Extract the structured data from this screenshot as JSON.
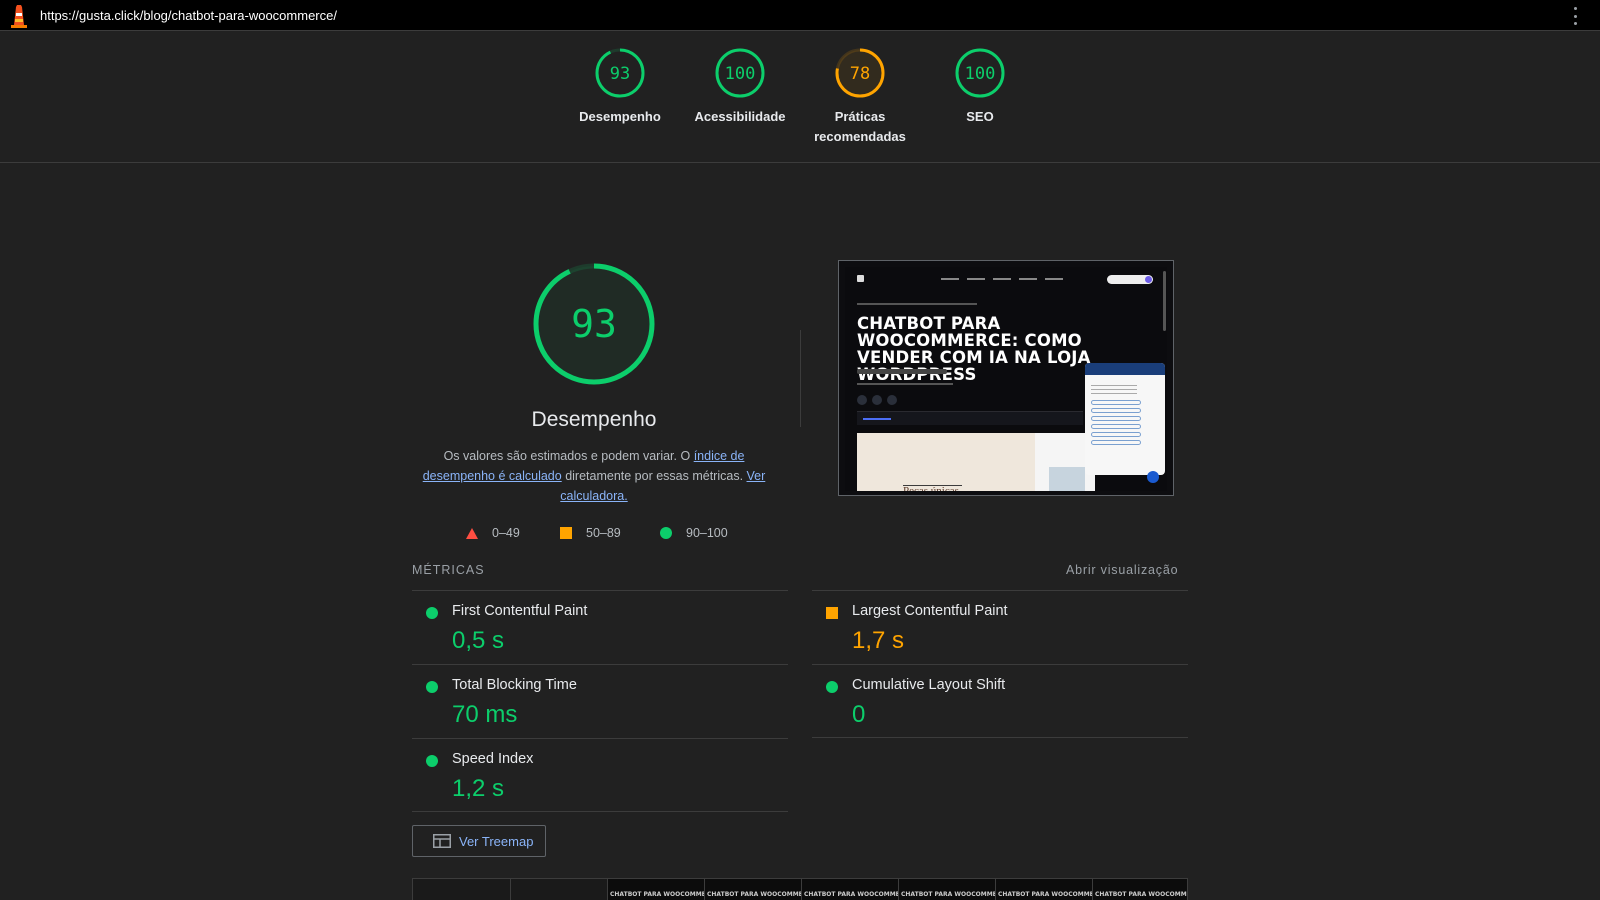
{
  "browser": {
    "url": "https://gusta.click/blog/chatbot-para-woocommerce/"
  },
  "colors": {
    "pass": "#0cce6b",
    "average": "#ffa400",
    "fail": "#ff4e42"
  },
  "categories": [
    {
      "score": "93",
      "label": "Desempenho",
      "level": "pass"
    },
    {
      "score": "100",
      "label": "Acessibilidade",
      "level": "pass"
    },
    {
      "score": "78",
      "label": "Práticas recomendadas",
      "level": "average"
    },
    {
      "score": "100",
      "label": "SEO",
      "level": "pass"
    }
  ],
  "performance": {
    "score": "93",
    "title": "Desempenho",
    "desc_pre": "Os valores são estimados e podem variar. O ",
    "desc_link1": "índice de desempenho é calculado",
    "desc_mid": " diretamente por essas métricas. ",
    "desc_link2": "Ver calculadora."
  },
  "legend": {
    "fail": "0–49",
    "average": "50–89",
    "pass": "90–100"
  },
  "screenshot": {
    "headline": "CHATBOT PARA WOOCOMMERCE: COMO VENDER COM IA NA LOJA WORDPRESS",
    "hero_text": "Peças únicas,"
  },
  "metrics": {
    "title": "MÉTRICAS",
    "toggle": "Abrir visualização",
    "items": [
      {
        "name": "First Contentful Paint",
        "value": "0,5 s",
        "level": "pass"
      },
      {
        "name": "Largest Contentful Paint",
        "value": "1,7 s",
        "level": "average"
      },
      {
        "name": "Total Blocking Time",
        "value": "70 ms",
        "level": "pass"
      },
      {
        "name": "Cumulative Layout Shift",
        "value": "0",
        "level": "pass"
      },
      {
        "name": "Speed Index",
        "value": "1,2 s",
        "level": "pass"
      }
    ]
  },
  "treemap": {
    "label": "Ver Treemap"
  },
  "filmstrip": {
    "frame_text": "CHATBOT PARA WOOCOMME"
  }
}
